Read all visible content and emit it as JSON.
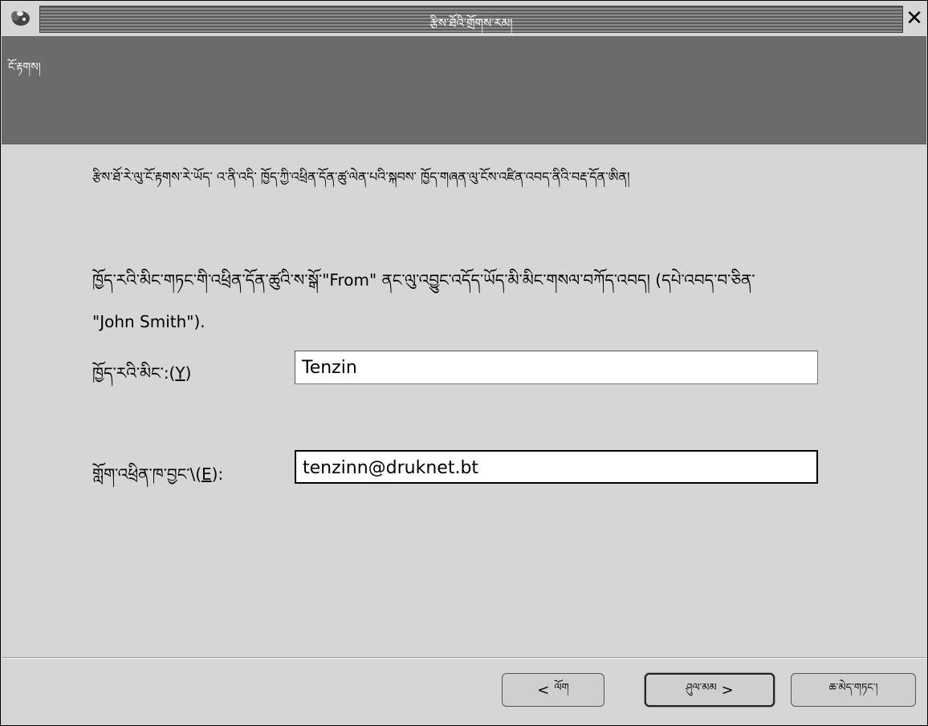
{
  "window": {
    "title": "རྩིས་ཐོའི་གྲོགས་རམ།"
  },
  "header": {
    "title": "ངོ་རྟགས།"
  },
  "intro": {
    "text": "རྩིས་ཐོ་རེ་ལུ་ངོ་རྟགས་རེ་ཡོད་ འ་ནི་འདི་ ཁྱོད་ཀྱི་འཕྲིན་དོན་ཚུ་ལེན་པའི་སྐབས་ ཁྱོད་གཞན་ལུ་ངོས་འཛིན་འབད་ནིའི་བརྡ་དོན་ཨིན།"
  },
  "instruction": {
    "text_prefix": "ཁྱོད་རའི་མིང་གཏང་གི་འཕྲིན་དོན་ཚུའི་ས་སྒོ་",
    "from": "\"From\"",
    "text_mid": " ནང་ལུ་འབྱུང་འདོད་ཡོད་མི་མིང་གསལ་བཀོད་འབད། (དཔེ་འབད་བ་ཅིན་",
    "example": "\"John Smith\")."
  },
  "form": {
    "name_label_prefix": "ཁྱོད་རའི་མིང་:(",
    "name_label_mnemonic": "Y",
    "name_label_suffix": ")",
    "name_value": "Tenzin",
    "email_label_prefix": "གློག་འཕྲིན་ཁ་བྱང་\\(",
    "email_label_mnemonic": "E",
    "email_label_suffix": "):",
    "email_value": "tenzinn@druknet.bt"
  },
  "buttons": {
    "back_arrow": "<",
    "back_label": "ལོག",
    "forward_label": "ཤུལ་མམ",
    "forward_arrow": ">",
    "cancel_label": "ཆ་མེད་གཏང་།"
  }
}
